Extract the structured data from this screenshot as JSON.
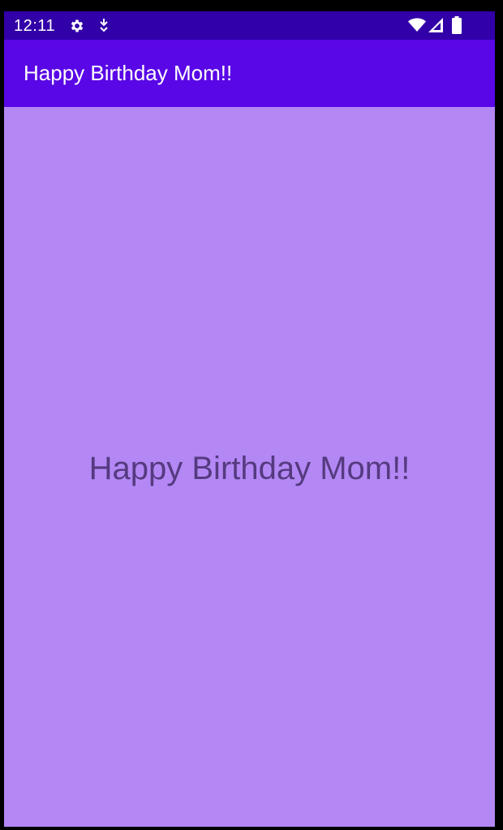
{
  "status_bar": {
    "time": "12:11",
    "icons": [
      "gear-icon",
      "download-arrow-icon",
      "wifi-icon",
      "cell-signal-icon",
      "battery-icon"
    ]
  },
  "app_bar": {
    "title": "Happy Birthday Mom!!"
  },
  "main": {
    "message": "Happy Birthday Mom!!"
  },
  "colors": {
    "status_bar": "#3200a8",
    "app_bar": "#5907e6",
    "background": "#b388f4",
    "message_text": "#553a80"
  }
}
